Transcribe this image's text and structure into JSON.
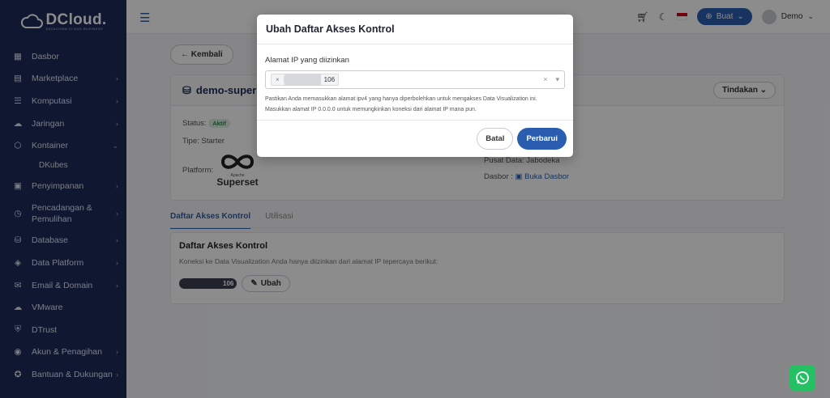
{
  "brand": {
    "name": "DCloud.",
    "tagline": "DATACOMM CLOUD BUSINESS"
  },
  "sidebar": {
    "items": [
      {
        "label": "Dasbor",
        "icon": "grid-icon",
        "chevron": false
      },
      {
        "label": "Marketplace",
        "icon": "store-icon",
        "chevron": true
      },
      {
        "label": "Komputasi",
        "icon": "server-icon",
        "chevron": true
      },
      {
        "label": "Jaringan",
        "icon": "cloud-icon",
        "chevron": true
      },
      {
        "label": "Kontainer",
        "icon": "box-icon",
        "chevron": true,
        "expanded": true
      },
      {
        "label": "Penyimpanan",
        "icon": "storage-icon",
        "chevron": true
      },
      {
        "label": "Pencadangan & Pemulihan",
        "icon": "backup-icon",
        "chevron": true
      },
      {
        "label": "Database",
        "icon": "database-icon",
        "chevron": true
      },
      {
        "label": "Data Platform",
        "icon": "layers-icon",
        "chevron": true
      },
      {
        "label": "Email & Domain",
        "icon": "mail-icon",
        "chevron": true
      },
      {
        "label": "VMware",
        "icon": "vmware-cloud-icon",
        "chevron": false
      },
      {
        "label": "DTrust",
        "icon": "shield-icon",
        "chevron": false
      },
      {
        "label": "Akun & Penagihan",
        "icon": "user-icon",
        "chevron": true
      },
      {
        "label": "Bantuan & Dukungan",
        "icon": "support-icon",
        "chevron": true
      }
    ],
    "sub_item": "DKubes"
  },
  "topbar": {
    "create_label": "Buat",
    "user_label": "Demo"
  },
  "page": {
    "back_label": "Kembali",
    "title": "demo-superse",
    "actions_label": "Tindakan",
    "status_label": "Status:",
    "status_value": "Aktif",
    "type_label": "Tipe:",
    "type_value": "Starter",
    "platform_label": "Platform:",
    "platform_name": "Superset",
    "platform_caption": "Apache",
    "dc_label": "Pusat Data:",
    "dc_value": "Jabodeka",
    "dashboard_label": "Dasbor :",
    "dashboard_link": "Buka Dasbor",
    "tabs": [
      "Daftar Akses Kontrol",
      "Utilisasi"
    ],
    "acl_title": "Daftar Akses Kontrol",
    "acl_desc": "Koneksi ke Data Visualization Anda hanya diizinkan dari alamat IP tepercaya berikut:",
    "acl_ip_suffix": "106",
    "edit_label": "Ubah"
  },
  "modal": {
    "title": "Ubah Daftar Akses Kontrol",
    "field_label": "Alamat IP yang diizinkan",
    "chip_remove": "×",
    "chip_value": "106",
    "clear_glyph": "×",
    "hint_1": "Pastikan Anda memasukkan alamat ipv4 yang hanya diperbolehkan untuk mengakses Data Visualization ini.",
    "hint_2": "Masukkan alamat IP 0.0.0.0 untuk memungkinkan koneksi dari alamat IP mana pun.",
    "cancel_label": "Batal",
    "submit_label": "Perbarui"
  },
  "colors": {
    "sidebar_bg": "#1e2d5a",
    "primary": "#2a5db0",
    "whatsapp": "#25c063"
  }
}
